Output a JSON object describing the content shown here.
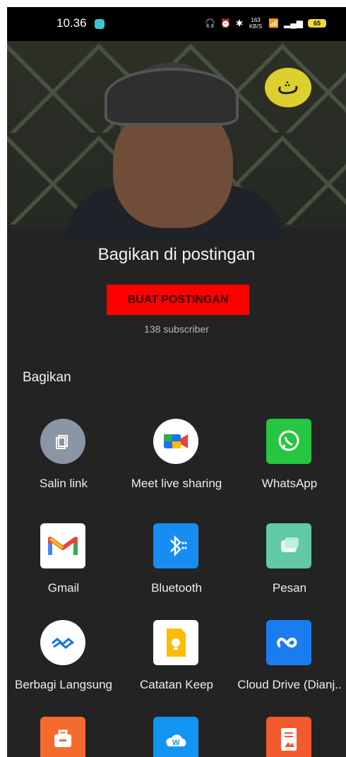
{
  "status_bar": {
    "time": "10.36",
    "speed": "163 KB/S",
    "battery": "65"
  },
  "video": {
    "badge": "ث"
  },
  "post": {
    "title": "Bagikan di postingan",
    "button": "BUAT POSTINGAN",
    "subscribers": "138 subscriber"
  },
  "share": {
    "title": "Bagikan",
    "apps": [
      {
        "label": "Salin link",
        "icon": "copy-icon"
      },
      {
        "label": "Meet live sharing",
        "icon": "meet-icon"
      },
      {
        "label": "WhatsApp",
        "icon": "whatsapp-icon"
      },
      {
        "label": "Gmail",
        "icon": "gmail-icon"
      },
      {
        "label": "Bluetooth",
        "icon": "bluetooth-icon"
      },
      {
        "label": "Pesan",
        "icon": "messages-icon"
      },
      {
        "label": "Berbagi Langsung",
        "icon": "direct-share-icon"
      },
      {
        "label": "Catatan Keep",
        "icon": "keep-icon"
      },
      {
        "label": "Cloud Drive (Dianj..",
        "icon": "cloud-drive-icon"
      },
      {
        "label": "",
        "icon": "briefcase-icon"
      },
      {
        "label": "",
        "icon": "wps-cloud-icon"
      },
      {
        "label": "",
        "icon": "document-image-icon"
      }
    ]
  },
  "colors": {
    "accent_red": "#ff0000",
    "background": "#232323"
  }
}
